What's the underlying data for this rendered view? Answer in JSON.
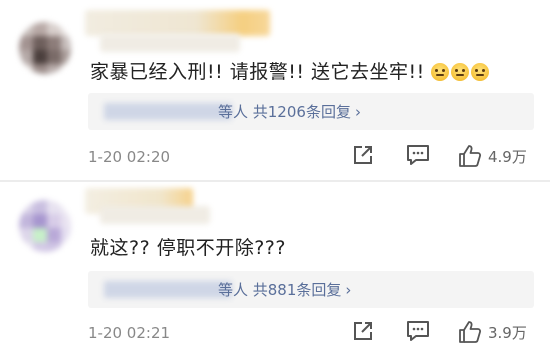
{
  "comments": [
    {
      "text": "家暴已经入刑!! 请报警!! 送它去坐牢!!",
      "emoji_icons": [
        "slight-smile-icon",
        "slight-smile-icon",
        "slight-smile-icon"
      ],
      "reply_summary": "等人  共1206条回复",
      "timestamp": "1-20 02:20",
      "likes": "4.9万"
    },
    {
      "text": "就这?? 停职不开除???",
      "reply_summary": "等人  共881条回复",
      "timestamp": "1-20 02:21",
      "likes": "3.9万"
    }
  ],
  "icons": {
    "share": "share-icon",
    "comment": "comment-icon",
    "like": "thumbs-up-icon",
    "reply_chevron": "chevron-right-icon"
  },
  "colors": {
    "reply_link": "#5a6f9a",
    "reply_background": "#f4f4f4",
    "meta_text": "#888888"
  }
}
